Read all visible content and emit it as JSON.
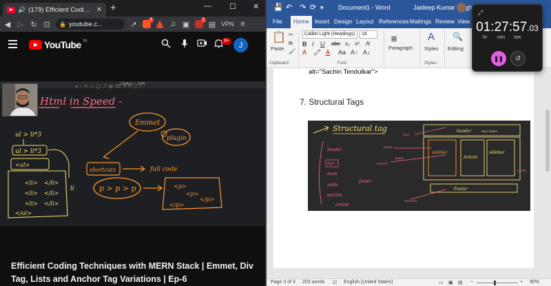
{
  "browser": {
    "tab_title": "(179) Efficient Coding Techniq",
    "tab_close": "✕",
    "new_tab": "+",
    "url": "youtube.c...",
    "vpn_label": "VPN",
    "ext_badge_1": "1",
    "ext_badge_2": "1",
    "window_controls": [
      "—",
      "☐",
      "✕"
    ]
  },
  "youtube": {
    "logo_text": "YouTube",
    "region": "IN",
    "notification_count": "9+",
    "avatar_initial": "J",
    "video_title": "Efficient Coding Techniques with MERN Stack | Emmet, Div Tag, Lists and Anchor Tag Variations | Ep-6",
    "board_title": "Untitled — 1080"
  },
  "whiteboard": {
    "title": "Html in Speed -",
    "notes": [
      "ul > li*3",
      "ul > li*3",
      "<ul>",
      "<li>",
      "</li>",
      "</ul>",
      "Emmet",
      "plugin",
      "shortcuts",
      "full code",
      "p > p > p",
      "<p>",
      "<p>",
      "</p>",
      "</p>",
      "li"
    ]
  },
  "word": {
    "quick_access": [
      "💾",
      "↶",
      "↷",
      "⟳",
      "▾"
    ],
    "doc_title": "Document1  -  Word",
    "user_name": "Jaideep Kumar Singh",
    "tabs": [
      "File",
      "Home",
      "Insert",
      "Design",
      "Layout",
      "References",
      "Mailings",
      "Review",
      "View"
    ],
    "ribbon": {
      "paste": "Paste",
      "clipboard": "Clipboard",
      "font_name": "Calibri Light (Headings)",
      "font_size": "18",
      "font_group": "Font",
      "paragraph": "Paragraph",
      "styles": "Styles",
      "styles_group": "Styles",
      "editing": "Editing"
    },
    "content": {
      "alt_line": "alt=\"Sachin Tendulkar\">",
      "heading": "7. Structural Tags"
    },
    "status": {
      "page": "Page 3 of 3",
      "words": "203 words",
      "language": "English (United States)",
      "zoom": "90%"
    }
  },
  "sketch": {
    "title": "Structural tag",
    "labels": [
      "header",
      "nav",
      "main",
      "aside",
      "section",
      "article",
      "footer",
      "sidebar",
      "Article",
      "Footer",
      "header",
      "nav",
      "main",
      "article",
      "aside",
      "section",
      "footer",
      "nav links",
      "aside"
    ]
  },
  "timer": {
    "hours": "01",
    "minutes": "27",
    "seconds": "57",
    "centis": ".03",
    "hr_label": "hr",
    "min_label": "min",
    "sec_label": "sec"
  },
  "colors": {
    "word_blue": "#2b579a",
    "youtube_red": "#ff0000",
    "chalk_orange": "#ff9a2a",
    "chalk_yellow": "#f3e070",
    "chalk_pink": "#ff6a8a",
    "timer_accent": "#e15fe7"
  }
}
